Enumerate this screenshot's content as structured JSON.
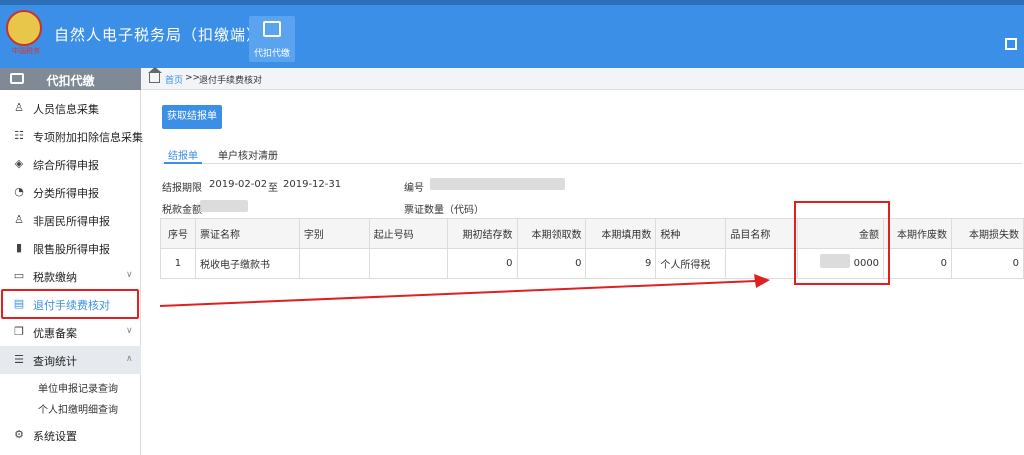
{
  "header": {
    "logo_text": "中国税务",
    "title": "自然人电子税务局（扣缴端）",
    "module_label": "代扣代缴"
  },
  "sidebar": {
    "heading": "代扣代缴",
    "items": [
      {
        "label": "人员信息采集",
        "icon": "person-icon"
      },
      {
        "label": "专项附加扣除信息采集",
        "icon": "list-icon"
      },
      {
        "label": "综合所得申报",
        "icon": "layers-icon"
      },
      {
        "label": "分类所得申报",
        "icon": "pie-icon"
      },
      {
        "label": "非居民所得申报",
        "icon": "person-icon"
      },
      {
        "label": "限售股所得申报",
        "icon": "bars-icon"
      },
      {
        "label": "税款缴纳",
        "icon": "folder-icon"
      },
      {
        "label": "退付手续费核对",
        "icon": "document-icon"
      },
      {
        "label": "优惠备案",
        "icon": "copy-icon"
      },
      {
        "label": "查询统计",
        "icon": "search-list-icon"
      },
      {
        "label": "系统设置",
        "icon": "gear-icon"
      }
    ],
    "sub_items": [
      "单位申报记录查询",
      "个人扣缴明细查询"
    ]
  },
  "breadcrumb": {
    "home": "首页",
    "separator": ">>",
    "current": "退付手续费核对"
  },
  "toolbar": {
    "fetch_button": "获取结报单"
  },
  "tabs": [
    "结报单",
    "单户核对清册"
  ],
  "info": {
    "period_label": "结报期限",
    "period_start": "2019-02-02",
    "period_to": "至",
    "period_end": "2019-12-31",
    "number_label": "编号",
    "tax_amount_label": "税款金额",
    "ticket_count_label": "票证数量（代码）"
  },
  "table": {
    "headers": [
      "序号",
      "票证名称",
      "字别",
      "起止号码",
      "期初结存数",
      "本期领取数",
      "本期填用数",
      "税种",
      "品目名称",
      "金额",
      "本期作废数",
      "本期损失数"
    ],
    "rows": [
      [
        "1",
        "税收电子缴款书",
        "",
        "",
        "0",
        "0",
        "9",
        "个人所得税",
        "",
        "0000",
        "0",
        "0"
      ]
    ]
  },
  "colors": {
    "header_blue": "#3b8fe6",
    "sidebar_head": "#7f8a96",
    "annotation_red": "#e02020"
  }
}
